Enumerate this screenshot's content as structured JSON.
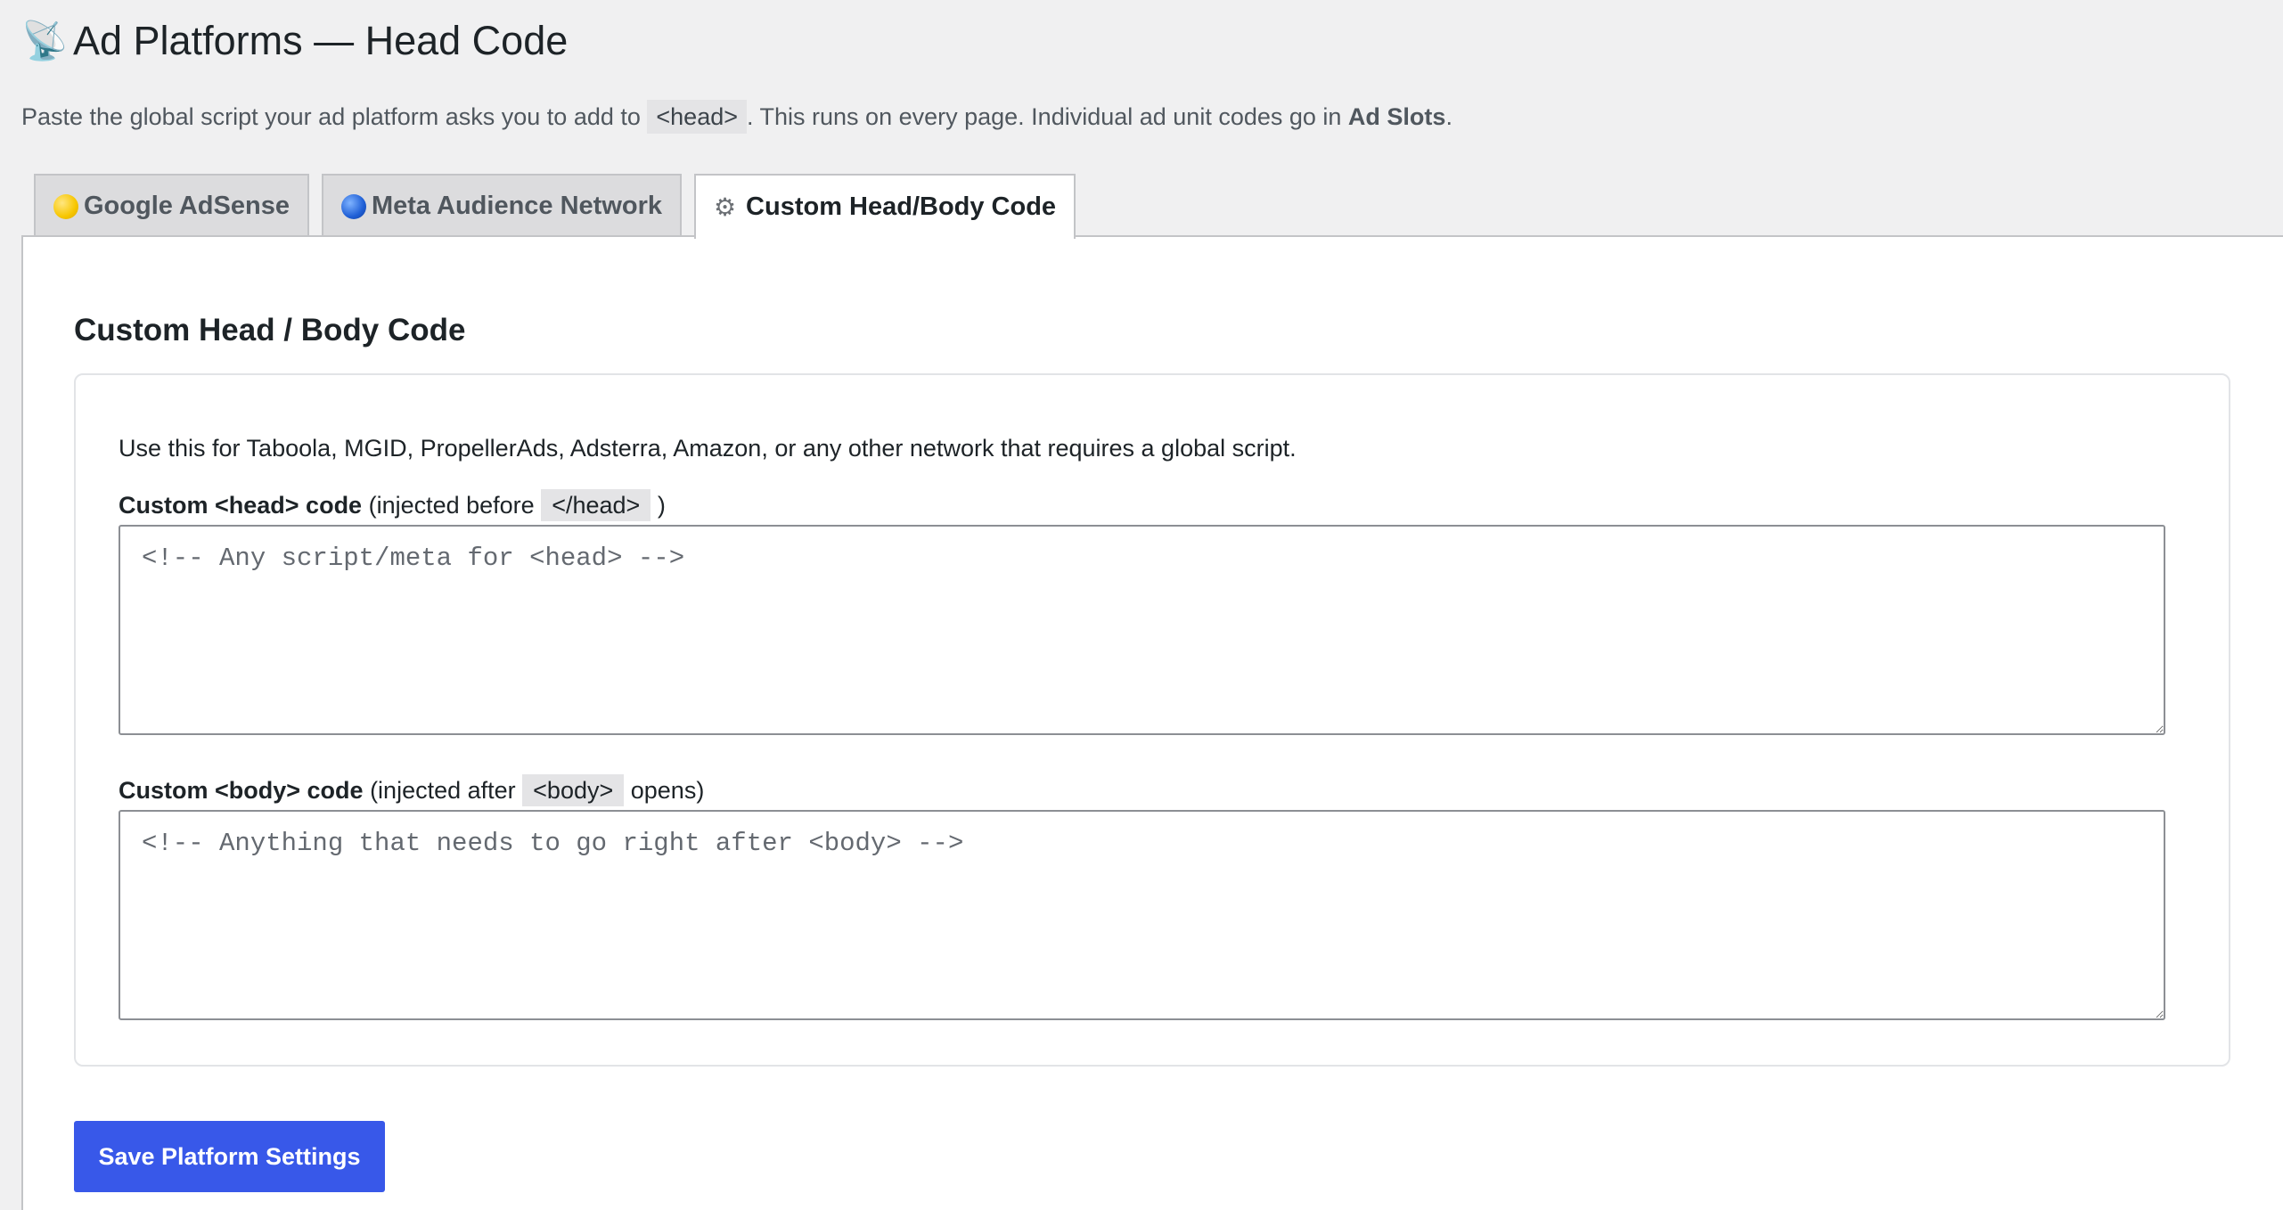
{
  "page": {
    "title_icon": "satellite-dish-icon",
    "title": "Ad Platforms — Head Code",
    "intro": {
      "before": "Paste the global script your ad platform asks you to add to ",
      "code": "<head>",
      "middle": ". This runs on every page. Individual ad unit codes go in ",
      "strong": "Ad Slots",
      "after": "."
    }
  },
  "tabs": [
    {
      "label": "Google AdSense",
      "icon": "yellow-circle-icon",
      "active": false
    },
    {
      "label": "Meta Audience Network",
      "icon": "blue-circle-icon",
      "active": false
    },
    {
      "label": "Custom Head/Body Code",
      "icon": "gear-icon",
      "active": true
    }
  ],
  "section": {
    "title": "Custom Head / Body Code",
    "description": "Use this for Taboola, MGID, PropellerAds, Adsterra, Amazon, or any other network that requires a global script.",
    "head_field": {
      "label_strong": "Custom <head> code",
      "label_pre": " (injected before ",
      "label_code": "</head>",
      "label_post": " )",
      "placeholder": "<!-- Any script/meta for <head> -->",
      "value": ""
    },
    "body_field": {
      "label_strong": "Custom <body> code",
      "label_pre": " (injected after ",
      "label_code": "<body>",
      "label_post": " opens)",
      "placeholder": "<!-- Anything that needs to go right after <body> -->",
      "value": ""
    }
  },
  "save_button": {
    "label": "Save Platform Settings"
  },
  "colors": {
    "accent": "#3858e9",
    "background": "#f0f0f1",
    "panel": "#ffffff"
  }
}
